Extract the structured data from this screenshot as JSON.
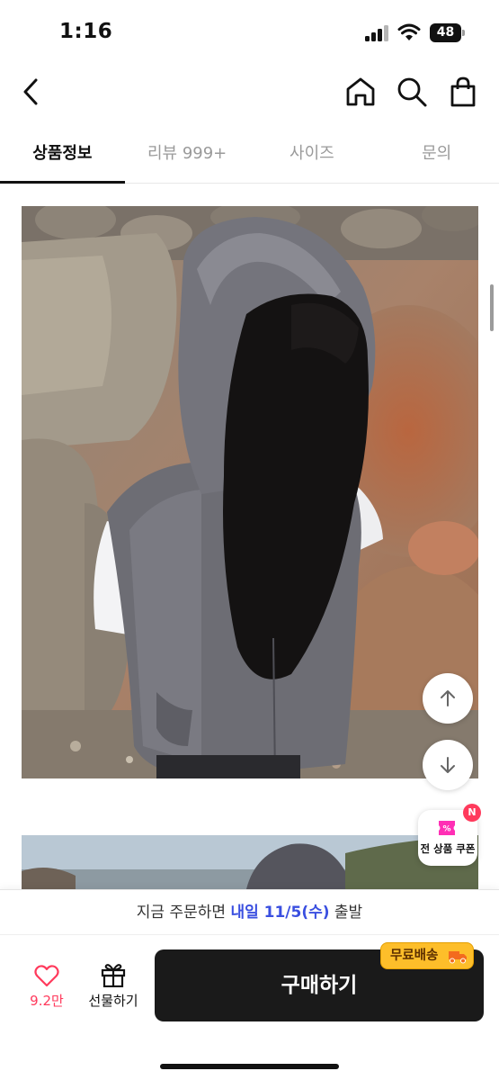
{
  "status_bar": {
    "time": "1:16",
    "battery": "48"
  },
  "tabs": [
    {
      "label": "상품정보",
      "active": true
    },
    {
      "label": "리뷰 999+",
      "active": false
    },
    {
      "label": "사이즈",
      "active": false
    },
    {
      "label": "문의",
      "active": false
    }
  ],
  "coupon": {
    "label": "전 상품 쿠폰",
    "badge": "N"
  },
  "delivery": {
    "prefix": "지금 주문하면 ",
    "highlight": "내일 11/5(수)",
    "suffix": " 출발"
  },
  "actions": {
    "like_count": "9.2만",
    "gift_label": "선물하기",
    "buy_label": "구매하기",
    "shipping_badge": "무료배송"
  },
  "colors": {
    "accent": "#3a4fe0",
    "like": "#ff3a5c",
    "badge": "#fdbe2a",
    "buy_bg": "#1a1a1a"
  }
}
